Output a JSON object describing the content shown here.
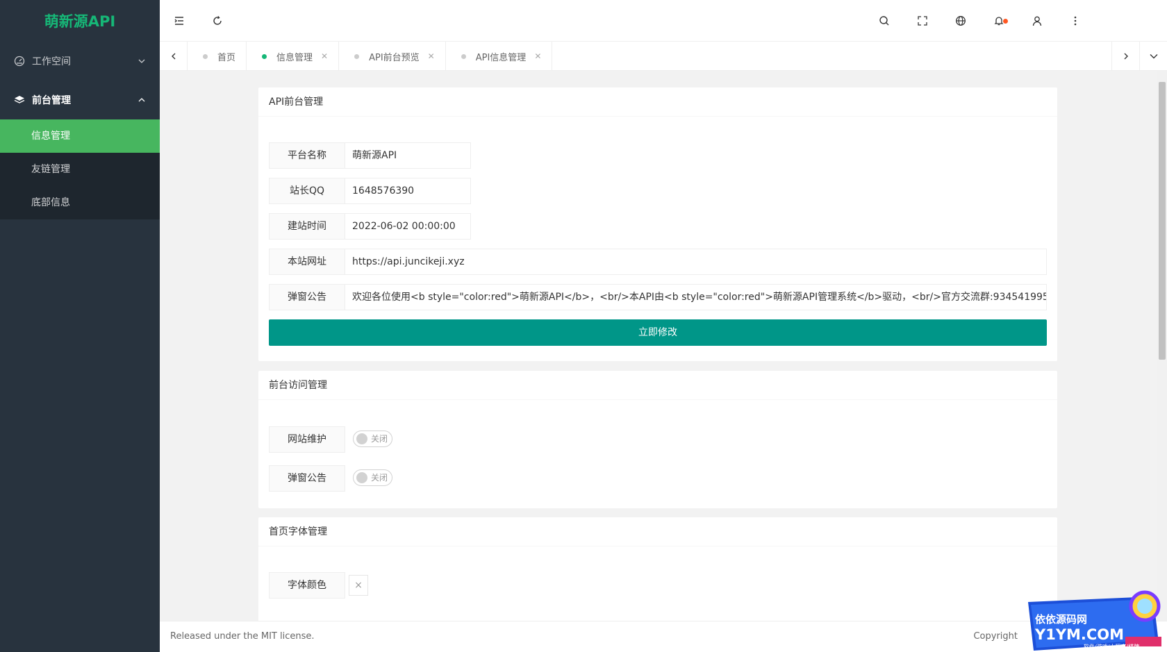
{
  "sidebar": {
    "logo": "萌新源API",
    "groups": [
      {
        "label": "工作空间",
        "icon": "dashboard-icon",
        "expanded": false
      },
      {
        "label": "前台管理",
        "icon": "layers-icon",
        "expanded": true
      }
    ],
    "sub_items": [
      {
        "label": "信息管理",
        "active": true
      },
      {
        "label": "友链管理",
        "active": false
      },
      {
        "label": "底部信息",
        "active": false
      }
    ]
  },
  "header": {
    "left_icons": [
      "menu-toggle-icon",
      "refresh-icon"
    ],
    "right_icons": [
      "search-icon",
      "fullscreen-icon",
      "globe-icon",
      "bell-icon",
      "user-icon",
      "more-vertical-icon"
    ],
    "notification_dot_color": "#ff5722"
  },
  "tabs": [
    {
      "label": "首页",
      "active": false,
      "closable": false
    },
    {
      "label": "信息管理",
      "active": true,
      "closable": true
    },
    {
      "label": "API前台预览",
      "active": false,
      "closable": true
    },
    {
      "label": "API信息管理",
      "active": false,
      "closable": true
    }
  ],
  "cards": {
    "api": {
      "title": "API前台管理",
      "fields": [
        {
          "label": "平台名称",
          "value": "萌新源API"
        },
        {
          "label": "站长QQ",
          "value": "1648576390"
        },
        {
          "label": "建站时间",
          "value": "2022-06-02 00:00:00"
        },
        {
          "label": "本站网址",
          "value": "https://api.juncikeji.xyz"
        },
        {
          "label": "弹窗公告",
          "value": "欢迎各位使用<b style=\"color:red\">萌新源API</b>，<br/>本API由<b style=\"color:red\">萌新源API管理系统</b>驱动，<br/>官方交流群:934541995"
        }
      ],
      "submit_label": "立即修改"
    },
    "access": {
      "title": "前台访问管理",
      "switches": [
        {
          "label": "网站维护",
          "state": "关闭"
        },
        {
          "label": "弹窗公告",
          "state": "关闭"
        }
      ]
    },
    "font": {
      "title": "首页字体管理",
      "color_label": "字体颜色",
      "color_clear": "×"
    }
  },
  "footer": {
    "license": "Released under the MIT license.",
    "copyright": "Copyright"
  },
  "watermark": {
    "line1": "依依源码网",
    "line2": "Y1YM.COM",
    "line3": "软件/游戏/小程序/棋牌"
  },
  "colors": {
    "sidebar_bg": "#28333e",
    "active_green": "#47b65f",
    "brand_green": "#16b777",
    "primary_button": "#009688"
  }
}
